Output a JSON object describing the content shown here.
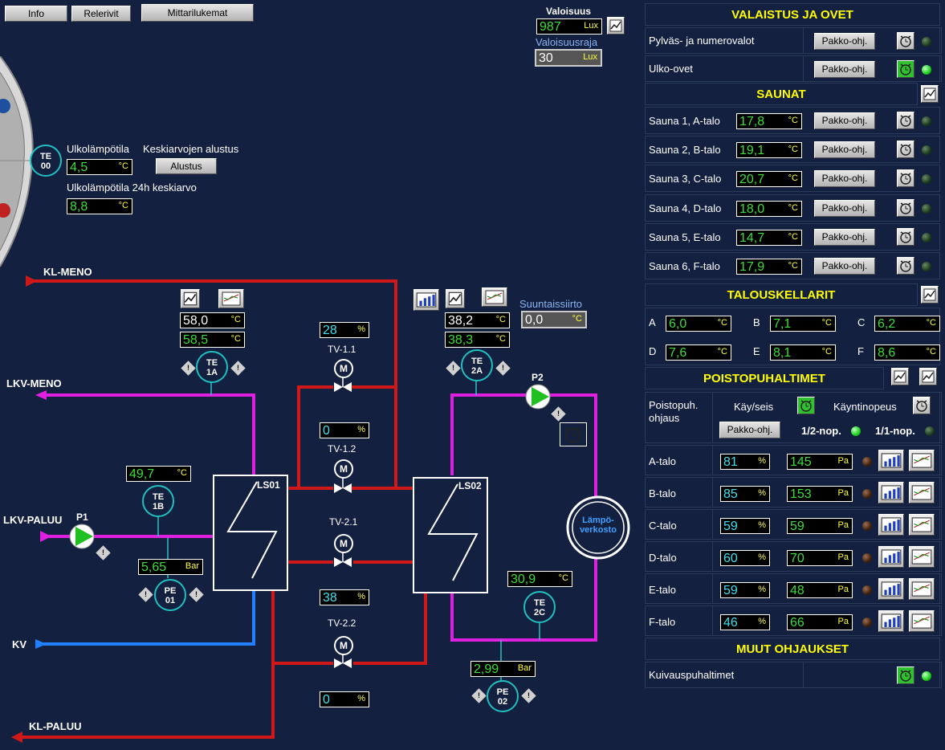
{
  "toolbar": {
    "info": "Info",
    "relerivit": "Relerivit",
    "mittarilukemat": "Mittarilukemat"
  },
  "illum": {
    "title": "Valoisuus",
    "value": "987",
    "unit": "Lux",
    "limit_label": "Valoisuusraja",
    "limit_value": "30",
    "limit_unit": "Lux"
  },
  "outdoor": {
    "sensor_top": "TE",
    "sensor_bottom": "00",
    "temp_label": "Ulkolämpötila",
    "temp_value": "4,5",
    "temp_unit": "°C",
    "reset_label": "Keskiarvojen alustus",
    "reset_button": "Alustus",
    "avg_label": "Ulkolämpötila 24h keskiarvo",
    "avg_value": "8,8",
    "avg_unit": "°C"
  },
  "pipes": {
    "kl_meno": "KL-MENO",
    "lkv_meno": "LKV-MENO",
    "lkv_paluu": "LKV-PALUU",
    "kv": "KV",
    "kl_paluu": "KL-PALUU"
  },
  "process": {
    "te1a": {
      "top": "TE",
      "bottom": "1A",
      "v1": "58,0",
      "v2": "58,5",
      "unit": "°C"
    },
    "te2a": {
      "top": "TE",
      "bottom": "2A",
      "v1": "38,2",
      "v2": "38,3",
      "unit": "°C"
    },
    "te1b": {
      "top": "TE",
      "bottom": "1B",
      "v": "49,7",
      "unit": "°C"
    },
    "te2c": {
      "top": "TE",
      "bottom": "2C",
      "v": "30,9",
      "unit": "°C"
    },
    "pe01": {
      "top": "PE",
      "bottom": "01",
      "v": "5,65",
      "unit": "Bar"
    },
    "pe02": {
      "top": "PE",
      "bottom": "02",
      "v": "2,99",
      "unit": "Bar"
    },
    "shift_label": "Suuntaissiirto",
    "shift_value": "0,0",
    "shift_unit": "°C",
    "tv11": {
      "label": "TV-1.1",
      "value": "28",
      "unit": "%"
    },
    "tv12": {
      "label": "TV-1.2",
      "value": "0",
      "unit": "%"
    },
    "tv21": {
      "label": "TV-2.1",
      "value": "38",
      "unit": "%"
    },
    "tv22": {
      "label": "TV-2.2",
      "value": "0",
      "unit": "%"
    },
    "motor": "M",
    "ls01": "LS01",
    "ls02": "LS02",
    "p1": "P1",
    "p2": "P2",
    "network": "Lämpö-\nverkosto"
  },
  "panel": {
    "valaistus_title": "VALAISTUS JA OVET",
    "pakko": "Pakko-ohj.",
    "lights": [
      {
        "label": "Pylväs- ja numerovalot",
        "led": "off"
      },
      {
        "label": "Ulko-ovet",
        "led": "on"
      }
    ],
    "saunat_title": "SAUNAT",
    "saunat": [
      {
        "label": "Sauna 1, A-talo",
        "value": "17,8",
        "unit": "°C"
      },
      {
        "label": "Sauna 2, B-talo",
        "value": "19,1",
        "unit": "°C"
      },
      {
        "label": "Sauna 3, C-talo",
        "value": "20,7",
        "unit": "°C"
      },
      {
        "label": "Sauna 4, D-talo",
        "value": "18,0",
        "unit": "°C"
      },
      {
        "label": "Sauna 5, E-talo",
        "value": "14,7",
        "unit": "°C"
      },
      {
        "label": "Sauna 6, F-talo",
        "value": "17,9",
        "unit": "°C"
      }
    ],
    "kellarit_title": "TALOUSKELLARIT",
    "kellarit": [
      {
        "label": "A",
        "value": "6,0",
        "unit": "°C"
      },
      {
        "label": "B",
        "value": "7,1",
        "unit": "°C"
      },
      {
        "label": "C",
        "value": "6,2",
        "unit": "°C"
      },
      {
        "label": "D",
        "value": "7,6",
        "unit": "°C"
      },
      {
        "label": "E",
        "value": "8,1",
        "unit": "°C"
      },
      {
        "label": "F",
        "value": "8,6",
        "unit": "°C"
      }
    ],
    "poisto_title": "POISTOPUHALTIMET",
    "poisto_ctrl_label": "Poistopuh. ohjaus",
    "kay_seis": "Käy/seis",
    "kayntinopeus": "Käyntinopeus",
    "half_speed": "1/2-nop.",
    "full_speed": "1/1-nop.",
    "fans": [
      {
        "label": "A-talo",
        "pct": "81",
        "pa": "145"
      },
      {
        "label": "B-talo",
        "pct": "85",
        "pa": "153"
      },
      {
        "label": "C-talo",
        "pct": "59",
        "pa": "59"
      },
      {
        "label": "D-talo",
        "pct": "60",
        "pa": "70"
      },
      {
        "label": "E-talo",
        "pct": "59",
        "pa": "48"
      },
      {
        "label": "F-talo",
        "pct": "46",
        "pa": "66"
      }
    ],
    "pct_unit": "%",
    "pa_unit": "Pa",
    "muut_title": "MUUT OHJAUKSET",
    "kuivaus": "Kuivauspuhaltimet"
  }
}
